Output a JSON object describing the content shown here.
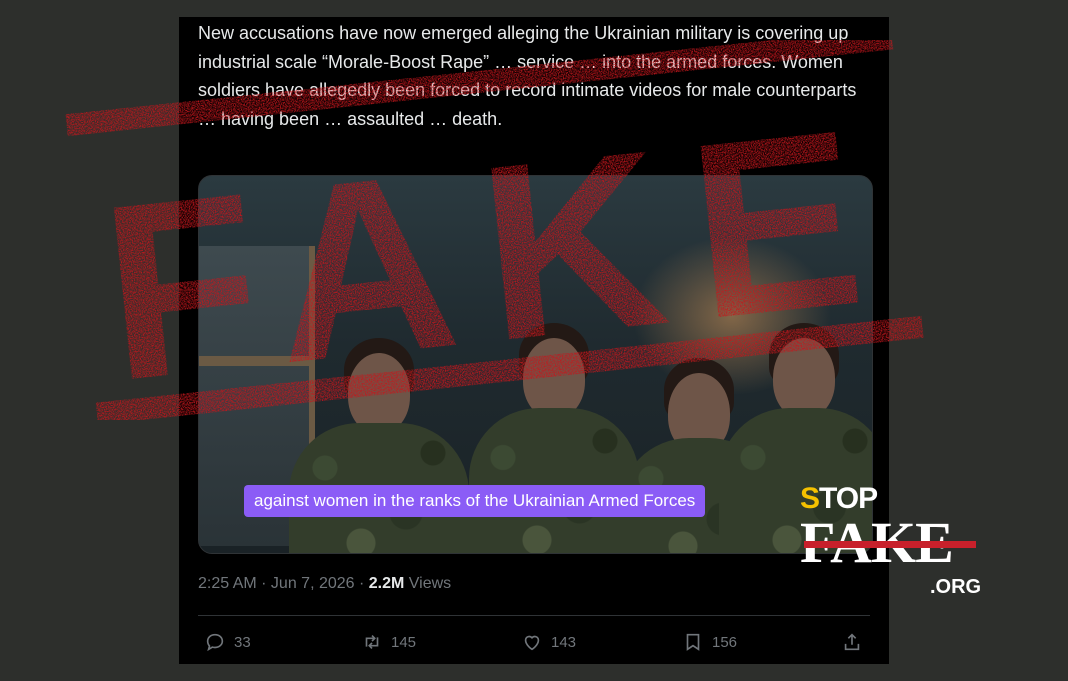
{
  "tweet": {
    "text": "New accusations have now emerged alleging the Ukrainian military is covering up industrial scale “Morale-Boost Rape” … service … into the armed forces. Women soldiers have allegedly been forced to record intimate videos for male counterparts … having been … assaulted … death.",
    "media_caption": "against women in the ranks of the Ukrainian Armed Forces",
    "time": "2:25 AM · Jun 7, 2026 · ",
    "views_count": "2.2M",
    "views_label": " Views",
    "actions": {
      "replies": "33",
      "reposts": "145",
      "likes": "143",
      "bookmarks": "156"
    }
  },
  "stamp": {
    "word": "FAKE",
    "color": "#c4161c"
  },
  "logo": {
    "stop_s": "S",
    "stop_rest": "TOP",
    "fake": "FAKE",
    "org": ".ORG"
  },
  "icons": [
    "reply-icon",
    "repost-icon",
    "like-icon",
    "bookmark-icon",
    "share-icon"
  ]
}
